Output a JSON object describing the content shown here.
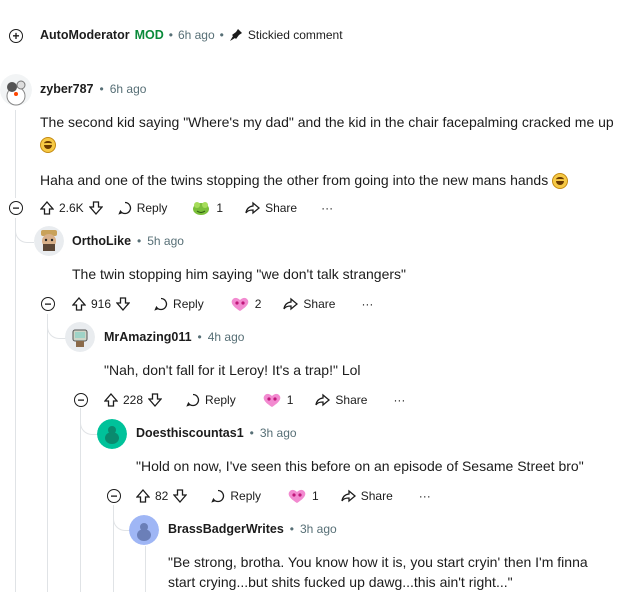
{
  "top_comment": {
    "author": "AutoModerator",
    "mod_badge": "MOD",
    "time": "6h ago",
    "stickied": "Stickied comment",
    "expand_icon": "plus-circle-icon",
    "pin_icon": "pin-icon"
  },
  "comments": [
    {
      "author": "zyber787",
      "time": "6h ago",
      "text_1": "The second kid saying \"Where's my dad\" and the kid in the chair facepalming cracked me up",
      "text_2": "Haha and one of the twins stopping the other from going into the new mans hands",
      "votes": "2.6K",
      "reply": "Reply",
      "award_count": "1",
      "share": "Share",
      "more": "···"
    },
    {
      "author": "OrthoLike",
      "time": "5h ago",
      "text": "The twin stopping him saying \"we don't talk strangers\"",
      "votes": "916",
      "reply": "Reply",
      "award_count": "2",
      "share": "Share",
      "more": "···"
    },
    {
      "author": "MrAmazing011",
      "time": "4h ago",
      "text": "\"Nah, don't fall for it Leroy! It's a trap!\" Lol",
      "votes": "228",
      "reply": "Reply",
      "award_count": "1",
      "share": "Share",
      "more": "···"
    },
    {
      "author": "Doesthiscountas1",
      "time": "3h ago",
      "text": "\"Hold on now, I've seen this before on an episode of Sesame Street bro\"",
      "votes": "82",
      "reply": "Reply",
      "award_count": "1",
      "share": "Share",
      "more": "···"
    },
    {
      "author": "BrassBadgerWrites",
      "time": "3h ago",
      "text_1": "\"Be strong, brotha. You know how it is, you start cryin' then I'm finna",
      "text_2": "start crying...but shits fucked up dawg...this ain't right...\""
    }
  ],
  "colors": {
    "mod": "#0a8a3a",
    "meta": "#576f76",
    "thread": "#e0e3e6",
    "text": "#1c1c1c"
  },
  "dot_sep": "•",
  "minus_sign": "−",
  "plus_sign": "+"
}
